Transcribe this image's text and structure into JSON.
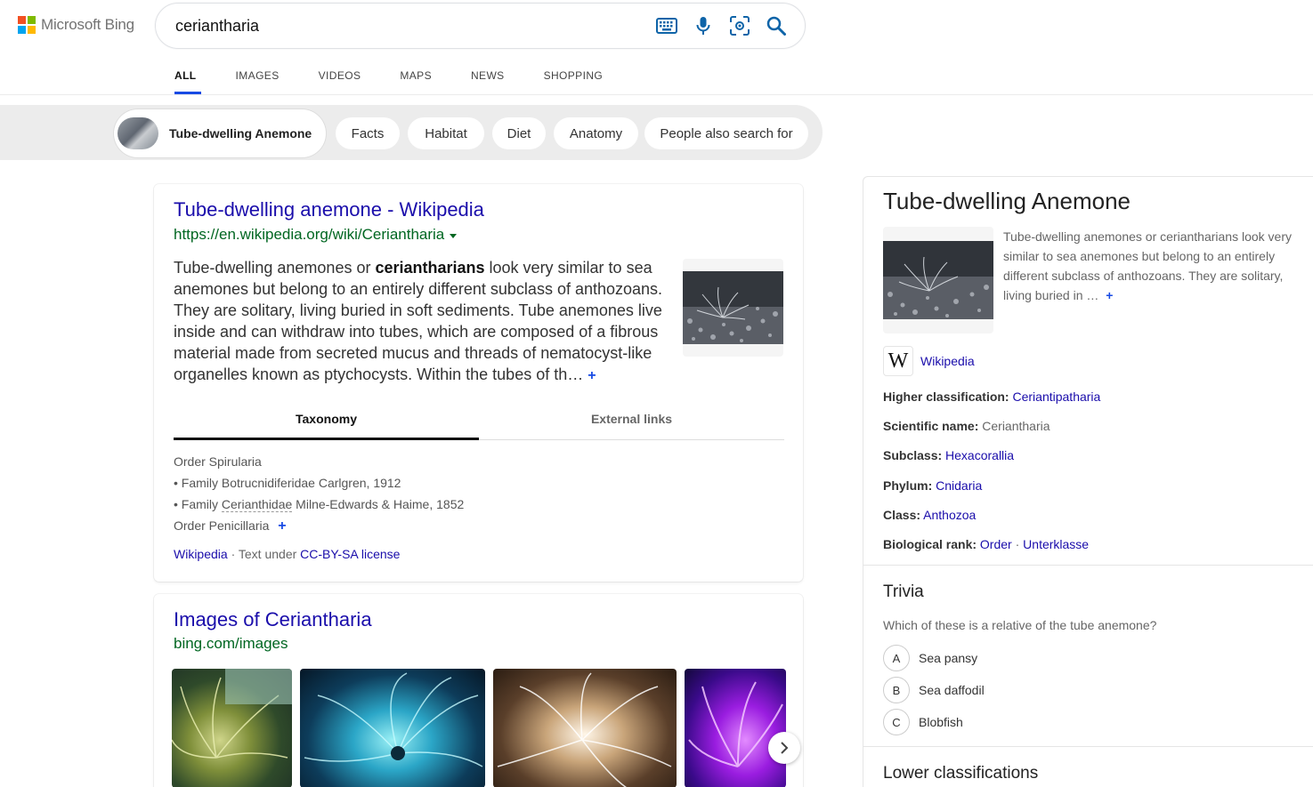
{
  "brand": {
    "name": "Microsoft Bing",
    "colors": [
      "#f25022",
      "#7fba00",
      "#00a4ef",
      "#ffb900"
    ]
  },
  "search": {
    "query": "ceriantharia"
  },
  "nav": {
    "tabs": [
      "ALL",
      "IMAGES",
      "VIDEOS",
      "MAPS",
      "NEWS",
      "SHOPPING"
    ],
    "active": "ALL"
  },
  "chips": {
    "main": "Tube-dwelling Anemone",
    "items": [
      "Facts",
      "Habitat",
      "Diet",
      "Anatomy",
      "People also search for"
    ]
  },
  "result1": {
    "title": "Tube-dwelling anemone - Wikipedia",
    "url": "https://en.wikipedia.org/wiki/Ceriantharia",
    "snippet_pre": "Tube-dwelling anemones or ",
    "snippet_bold": "ceriantharians",
    "snippet_post": " look very similar to sea anemones but belong to an entirely different subclass of anthozoans. They are solitary, living buried in soft sediments. Tube anemones live inside and can withdraw into tubes, which are composed of a fibrous material made from secreted mucus and threads of nematocyst-like organelles known as ptychocysts. Within the tubes of th…",
    "tabs": [
      "Taxonomy",
      "External links"
    ],
    "taxonomy": {
      "line1": "Order Spirularia",
      "line2": "• Family Botrucnidiferidae Carlgren, 1912",
      "line3_pre": "• Family ",
      "line3_dashed": "Cerianthidae",
      "line3_post": " Milne-Edwards & Haime, 1852",
      "line4": "Order Penicillaria"
    },
    "attribution": {
      "source": "Wikipedia",
      "middle": " · Text under ",
      "license": "CC-BY-SA license"
    }
  },
  "result2": {
    "title": "Images of Ceriantharia",
    "url": "bing.com/images"
  },
  "panel": {
    "title": "Tube-dwelling Anemone",
    "description": "Tube-dwelling anemones or ceriantharians look very similar to sea anemones but belong to an entirely different subclass of anthozoans. They are solitary, living buried in …",
    "source": "Wikipedia",
    "facts": [
      {
        "label": "Higher classification:",
        "links": [
          "Ceriantipatharia"
        ],
        "plain": ""
      },
      {
        "label": "Scientific name:",
        "links": [],
        "plain": "Ceriantharia"
      },
      {
        "label": "Subclass:",
        "links": [
          "Hexacorallia"
        ],
        "plain": ""
      },
      {
        "label": "Phylum:",
        "links": [
          "Cnidaria"
        ],
        "plain": ""
      },
      {
        "label": "Class:",
        "links": [
          "Anthozoa"
        ],
        "plain": ""
      },
      {
        "label": "Biological rank:",
        "links": [
          "Order",
          "Unterklasse"
        ],
        "plain": ""
      }
    ],
    "trivia": {
      "heading": "Trivia",
      "question": "Which of these is a relative of the tube anemone?",
      "options": [
        {
          "letter": "A",
          "text": "Sea pansy"
        },
        {
          "letter": "B",
          "text": "Sea daffodil"
        },
        {
          "letter": "C",
          "text": "Blobfish"
        }
      ]
    },
    "lower_heading": "Lower classifications"
  }
}
